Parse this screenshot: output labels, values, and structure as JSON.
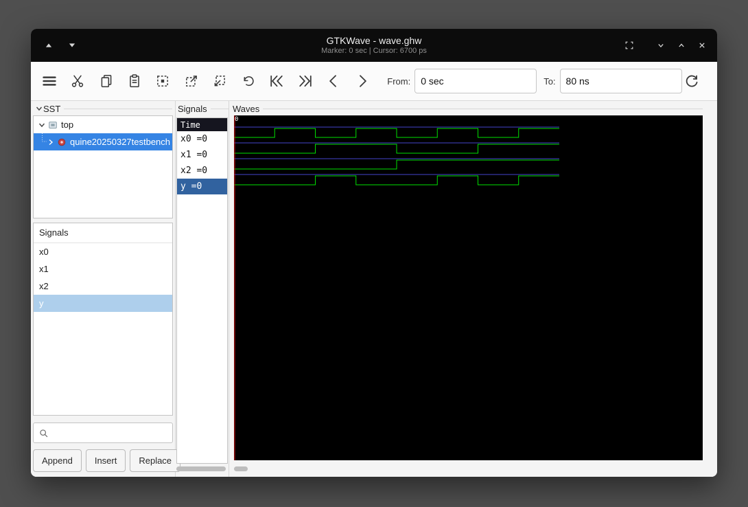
{
  "window": {
    "title": "GTKWave - wave.ghw",
    "subtitle": "Marker: 0 sec | Cursor: 6700 ps"
  },
  "titlebar": {
    "left_icons": [
      "triangle-up",
      "triangle-down"
    ],
    "right_icons": [
      "fit-window",
      "chevron-down",
      "chevron-up",
      "close"
    ]
  },
  "toolbar": {
    "icons": [
      "menu",
      "cut",
      "copy",
      "paste",
      "zoom-fit",
      "zoom-in",
      "zoom-out",
      "zoom-undo",
      "zoom-to-start",
      "zoom-to-end",
      "find-previous-edge",
      "find-next-edge",
      "reload"
    ],
    "from_label": "From:",
    "from_value": "0 sec",
    "to_label": "To:",
    "to_value": "80 ns"
  },
  "sst": {
    "header": "SST",
    "tree": [
      {
        "label": "top",
        "expanded": true,
        "selected": false
      },
      {
        "label": "quine20250327testbench",
        "expanded": false,
        "selected": true
      }
    ],
    "signals_header": "Signals",
    "signals": [
      "x0",
      "x1",
      "x2",
      "y"
    ],
    "selected_signal": "y",
    "search_value": "",
    "buttons": [
      "Append",
      "Insert",
      "Replace"
    ]
  },
  "signals_panel": {
    "label": "Signals",
    "time_header": "Time",
    "rows": [
      {
        "label": "x0 =0",
        "selected": false
      },
      {
        "label": "x1 =0",
        "selected": false
      },
      {
        "label": "x2 =0",
        "selected": false
      },
      {
        "label": "y =0",
        "selected": true
      }
    ]
  },
  "waves": {
    "label": "Waves",
    "timescale_label": "0",
    "total_ns": 80,
    "bit_ns": 10,
    "colors": {
      "bg": "#000000",
      "trace": "#00e000",
      "baseline": "#4444cc",
      "marker": "#e01010",
      "text": "#ffffff"
    },
    "signals": [
      {
        "name": "x0",
        "bits": [
          0,
          1,
          0,
          1,
          0,
          1,
          0,
          1
        ]
      },
      {
        "name": "x1",
        "bits": [
          0,
          0,
          1,
          1,
          0,
          0,
          1,
          1
        ]
      },
      {
        "name": "x2",
        "bits": [
          0,
          0,
          0,
          0,
          1,
          1,
          1,
          1
        ]
      },
      {
        "name": "y",
        "bits": [
          0,
          0,
          1,
          0,
          0,
          1,
          0,
          1
        ]
      }
    ],
    "selection_accent": "#3584e4"
  }
}
